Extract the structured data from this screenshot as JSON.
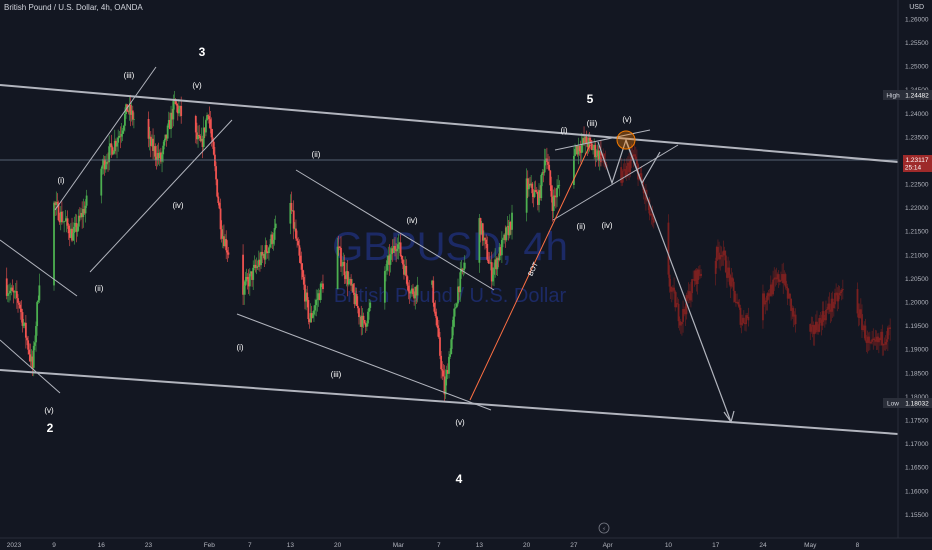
{
  "header": {
    "title": "British Pound / U.S. Dollar, 4h, OANDA",
    "unit": "USD"
  },
  "watermark": {
    "symbol": "GBPUSD, 4h",
    "name": "British Pound / U.S. Dollar"
  },
  "colors": {
    "background": "#131722",
    "up_candle": "#26a69a",
    "bright_up": "#4caf50",
    "down_candle": "#ef5350",
    "projection": "#7a2020",
    "channel": "#b2b5be",
    "watermark": "#1c2a66",
    "highlight": "#f57c00"
  },
  "price_axis": {
    "ticks": [
      "1.26000",
      "1.25500",
      "1.25000",
      "1.24500",
      "1.24000",
      "1.23500",
      "1.23000",
      "1.22500",
      "1.22000",
      "1.21500",
      "1.21000",
      "1.20500",
      "1.20000",
      "1.19500",
      "1.19000",
      "1.18500",
      "1.18000",
      "1.17500",
      "1.17000",
      "1.16500",
      "1.16000",
      "1.15500"
    ],
    "high_label": "High",
    "high_value": "1.24482",
    "current_value": "1.23117",
    "current_time": "25:14",
    "low_label": "Low",
    "low_value": "1.18032"
  },
  "time_axis": {
    "ticks": [
      "2023",
      "9",
      "16",
      "23",
      "Feb",
      "7",
      "13",
      "20",
      "Mar",
      "7",
      "13",
      "20",
      "27",
      "Apr",
      "10",
      "17",
      "24",
      "May",
      "8"
    ]
  },
  "wave_labels": [
    "3",
    "5",
    "2",
    "4",
    "(iii)",
    "(v)",
    "(i)",
    "(iv)",
    "(ii)",
    "(v)",
    "(ii)",
    "(iv)",
    "(i)",
    "(iii)",
    "(v)",
    "(i)",
    "(iii)",
    "(v)",
    "(ii)",
    "(iv)",
    "BOT"
  ],
  "chart_data": {
    "type": "candlestick",
    "instrument": "GBPUSD",
    "timeframe": "4h",
    "ylim": [
      1.15,
      1.264
    ],
    "xlim": [
      "2023-01-01",
      "2023-05-14"
    ],
    "high": 1.24482,
    "low": 1.18032,
    "last": 1.23117,
    "price_path": [
      {
        "date": "2023-01-01",
        "price": 1.205
      },
      {
        "date": "2023-01-04",
        "price": 1.2
      },
      {
        "date": "2023-01-06",
        "price": 1.186
      },
      {
        "date": "2023-01-07",
        "price": 1.205
      },
      {
        "date": "2023-01-09",
        "price": 1.221
      },
      {
        "date": "2023-01-12",
        "price": 1.214
      },
      {
        "date": "2023-01-16",
        "price": 1.228
      },
      {
        "date": "2023-01-19",
        "price": 1.236
      },
      {
        "date": "2023-01-20",
        "price": 1.241
      },
      {
        "date": "2023-01-25",
        "price": 1.23
      },
      {
        "date": "2023-01-27",
        "price": 1.242
      },
      {
        "date": "2023-01-31",
        "price": 1.233
      },
      {
        "date": "2023-02-01",
        "price": 1.241
      },
      {
        "date": "2023-02-03",
        "price": 1.215
      },
      {
        "date": "2023-02-06",
        "price": 1.202
      },
      {
        "date": "2023-02-10",
        "price": 1.212
      },
      {
        "date": "2023-02-13",
        "price": 1.222
      },
      {
        "date": "2023-02-16",
        "price": 1.196
      },
      {
        "date": "2023-02-20",
        "price": 1.212
      },
      {
        "date": "2023-02-24",
        "price": 1.195
      },
      {
        "date": "2023-03-01",
        "price": 1.213
      },
      {
        "date": "2023-03-03",
        "price": 1.202
      },
      {
        "date": "2023-03-06",
        "price": 1.205
      },
      {
        "date": "2023-03-08",
        "price": 1.181
      },
      {
        "date": "2023-03-10",
        "price": 1.203
      },
      {
        "date": "2023-03-13",
        "price": 1.218
      },
      {
        "date": "2023-03-15",
        "price": 1.206
      },
      {
        "date": "2023-03-20",
        "price": 1.225
      },
      {
        "date": "2023-03-22",
        "price": 1.222
      },
      {
        "date": "2023-03-23",
        "price": 1.232
      },
      {
        "date": "2023-03-24",
        "price": 1.221
      },
      {
        "date": "2023-03-27",
        "price": 1.232
      },
      {
        "date": "2023-03-29",
        "price": 1.234
      },
      {
        "date": "2023-03-31",
        "price": 1.231
      }
    ],
    "projection_path": [
      {
        "date": "2023-03-31",
        "price": 1.231
      },
      {
        "date": "2023-04-03",
        "price": 1.225
      },
      {
        "date": "2023-04-05",
        "price": 1.231
      },
      {
        "date": "2023-04-07",
        "price": 1.221
      },
      {
        "date": "2023-04-09",
        "price": 1.21
      },
      {
        "date": "2023-04-12",
        "price": 1.196
      },
      {
        "date": "2023-04-14",
        "price": 1.205
      },
      {
        "date": "2023-04-18",
        "price": 1.211
      },
      {
        "date": "2023-04-21",
        "price": 1.196
      },
      {
        "date": "2023-04-24",
        "price": 1.2
      },
      {
        "date": "2023-04-27",
        "price": 1.206
      },
      {
        "date": "2023-04-30",
        "price": 1.19
      },
      {
        "date": "2023-05-03",
        "price": 1.197
      },
      {
        "date": "2023-05-07",
        "price": 1.204
      },
      {
        "date": "2023-05-10",
        "price": 1.19
      },
      {
        "date": "2023-05-14",
        "price": 1.195
      }
    ],
    "channel_lines": [
      {
        "from": {
          "date": "2023-01-01",
          "price": 1.25
        },
        "to": {
          "date": "2023-05-14",
          "price": 1.231
        }
      },
      {
        "from": {
          "date": "2023-01-01",
          "price": 1.187
        },
        "to": {
          "date": "2023-05-14",
          "price": 1.173
        }
      }
    ],
    "forecast_arrow": {
      "from": {
        "date": "2023-03-31",
        "price": 1.236
      },
      "to": {
        "date": "2023-04-14",
        "price": 1.177
      }
    }
  }
}
